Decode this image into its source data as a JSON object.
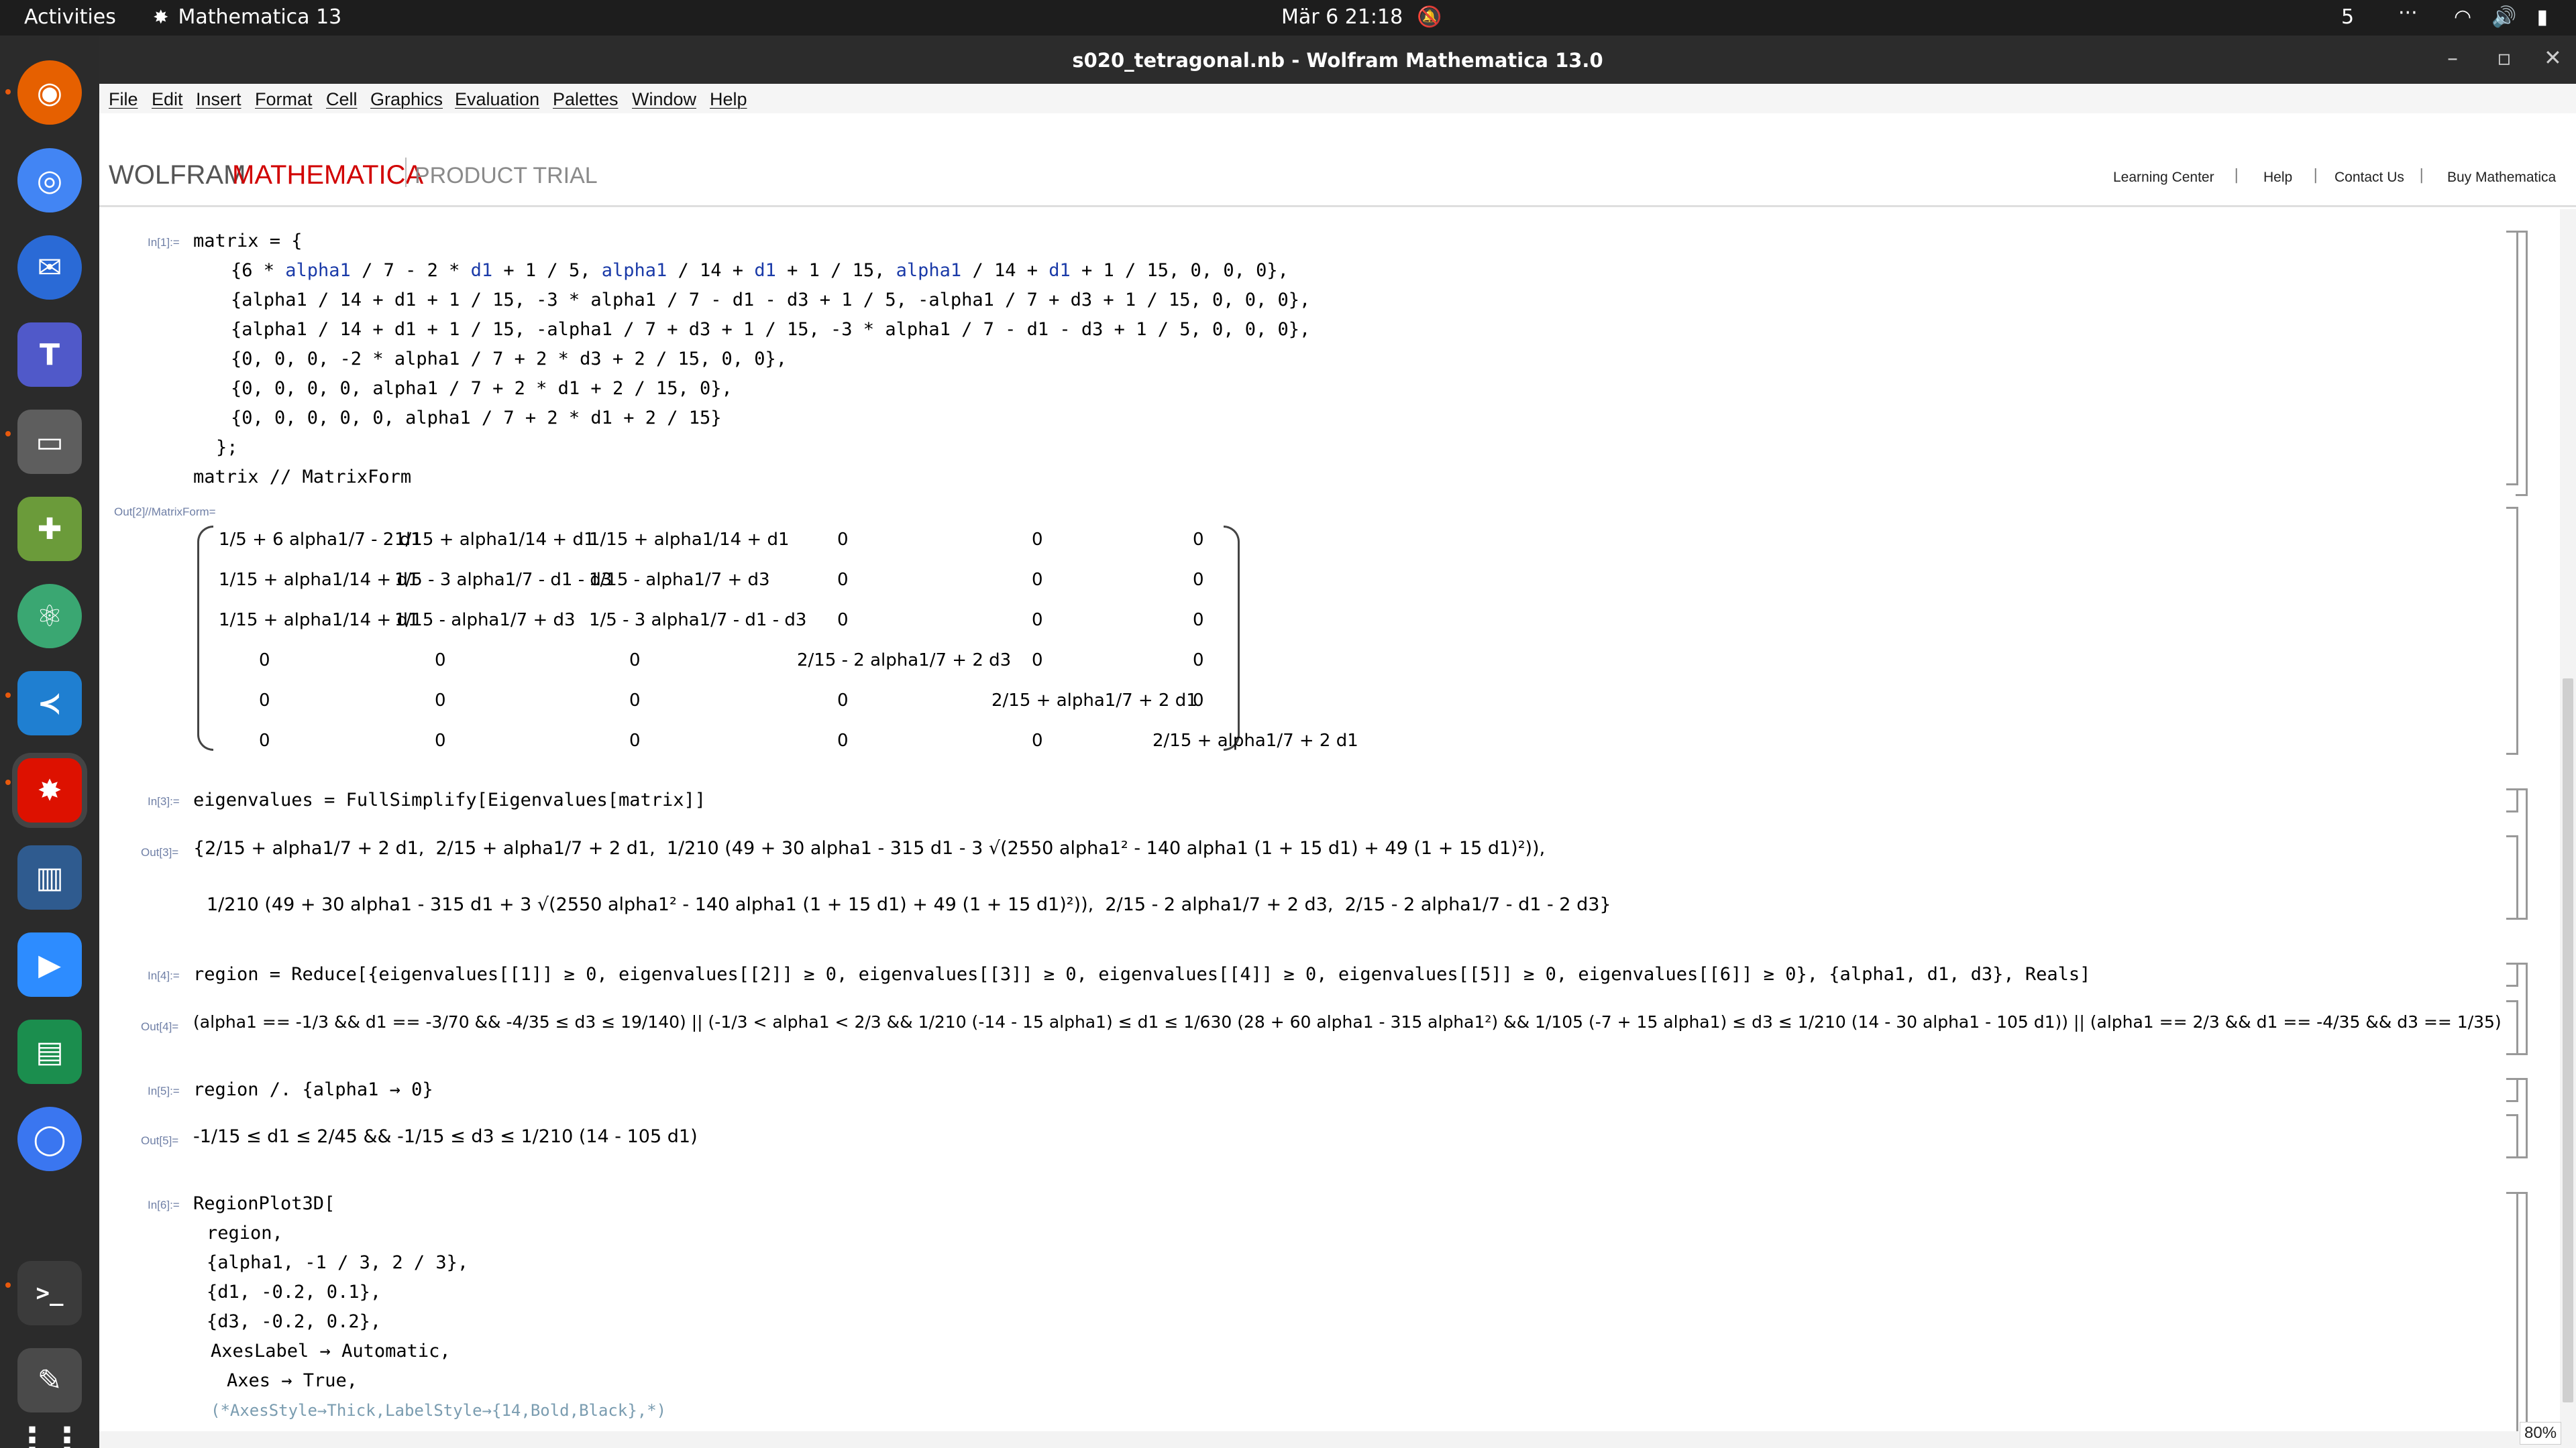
{
  "topbar": {
    "activities": "Activities",
    "app_name": "Mathematica 13",
    "clock": "Mär 6  21:18",
    "workspace": "5",
    "overflow": "···"
  },
  "window": {
    "title": "s020_tetragonal.nb - Wolfram Mathematica 13.0",
    "minimize": "–",
    "maximize": "▫",
    "close": "✕"
  },
  "menu": [
    "File",
    "Edit",
    "Insert",
    "Format",
    "Cell",
    "Graphics",
    "Evaluation",
    "Palettes",
    "Window",
    "Help"
  ],
  "brand": {
    "wolfram": "WOLFRAM",
    "mathematica": "MATHEMATICA",
    "trial": "PRODUCT TRIAL",
    "links": [
      "Learning Center",
      "Help",
      "Contact Us",
      "Buy Mathematica"
    ]
  },
  "cells": {
    "in1_label": "In[1]:=",
    "in1_line1": "matrix = {",
    "in1_line2a": "{6 * ",
    "in1_line2b": "alpha1",
    "in1_line2c": " / 7 - 2 * ",
    "in1_line2d": "d1",
    "in1_line2e": " + 1 / 5, ",
    "in1_line2f": "alpha1",
    "in1_line2g": " / 14 + ",
    "in1_line2h": "d1",
    "in1_line2i": " + 1 / 15, ",
    "in1_line2j": "alpha1",
    "in1_line2k": " / 14 + ",
    "in1_line2l": "d1",
    "in1_line2m": " + 1 / 15, 0, 0, 0},",
    "in1_line3": "{alpha1 / 14 + d1 + 1 / 15, -3 * alpha1 / 7 - d1 - d3 + 1 / 5, -alpha1 / 7 + d3 + 1 / 15, 0, 0, 0},",
    "in1_line4": "{alpha1 / 14 + d1 + 1 / 15, -alpha1 / 7 + d3 + 1 / 15, -3 * alpha1 / 7 - d1 - d3 + 1 / 5, 0, 0, 0},",
    "in1_line5": "{0, 0, 0, -2 * alpha1 / 7 + 2 * d3 + 2 / 15, 0, 0},",
    "in1_line6": "{0, 0, 0, 0, alpha1 / 7 + 2 * d1 + 2 / 15, 0},",
    "in1_line7": "{0, 0, 0, 0, 0, alpha1 / 7 + 2 * d1 + 2 / 15}",
    "in1_line8": "};",
    "in1_line9": "matrix // MatrixForm",
    "out2_label": "Out[2]//MatrixForm=",
    "in3_label": "In[3]:=",
    "in3_code": "eigenvalues = FullSimplify[Eigenvalues[matrix]]",
    "out3_label": "Out[3]=",
    "out3_line1": "{2/15 + alpha1/7 + 2 d1,  2/15 + alpha1/7 + 2 d1,  1/210 (49 + 30 alpha1 - 315 d1 - 3 √(2550 alpha1² - 140 alpha1 (1 + 15 d1) + 49 (1 + 15 d1)²)),",
    "out3_line2": "1/210 (49 + 30 alpha1 - 315 d1 + 3 √(2550 alpha1² - 140 alpha1 (1 + 15 d1) + 49 (1 + 15 d1)²)),  2/15 - 2 alpha1/7 + 2 d3,  2/15 - 2 alpha1/7 - d1 - 2 d3}",
    "in4_label": "In[4]:=",
    "in4_code": "region = Reduce[{eigenvalues[[1]] ≥ 0, eigenvalues[[2]] ≥ 0, eigenvalues[[3]] ≥ 0, eigenvalues[[4]] ≥ 0, eigenvalues[[5]] ≥ 0, eigenvalues[[6]] ≥ 0}, {alpha1, d1, d3}, Reals]",
    "out4_label": "Out[4]=",
    "out4_text": "(alpha1 == -1/3 && d1 == -3/70 && -4/35 ≤ d3 ≤ 19/140) || (-1/3 < alpha1 < 2/3 && 1/210 (-14 - 15 alpha1) ≤ d1 ≤ 1/630 (28 + 60 alpha1 - 315 alpha1²) && 1/105 (-7 + 15 alpha1) ≤ d3 ≤ 1/210 (14 - 30 alpha1 - 105 d1)) || (alpha1 == 2/3 && d1 == -4/35 && d3 == 1/35)",
    "in5_label": "In[5]:=",
    "in5_code": "region /. {alpha1 → 0}",
    "out5_label": "Out[5]=",
    "out5_text": "-1/15 ≤ d1 ≤ 2/45 && -1/15 ≤ d3 ≤ 1/210 (14 - 105 d1)",
    "in6_label": "In[6]:=",
    "in6_line1": "RegionPlot3D[",
    "in6_line2": "region,",
    "in6_line3": "{alpha1, -1 / 3, 2 / 3},",
    "in6_line4": "{d1, -0.2, 0.1},",
    "in6_line5": "{d3, -0.2, 0.2},",
    "in6_line6": "AxesLabel → Automatic,",
    "in6_line7": "Axes → True,",
    "in6_line8": "(*AxesStyle→Thick,LabelStyle→{14,Bold,Black},*)"
  },
  "matrix": [
    [
      "1/5 + 6 alpha1/7 - 2 d1",
      "1/15 + alpha1/14 + d1",
      "1/15 + alpha1/14 + d1",
      "0",
      "0",
      "0"
    ],
    [
      "1/15 + alpha1/14 + d1",
      "1/5 - 3 alpha1/7 - d1 - d3",
      "1/15 - alpha1/7 + d3",
      "0",
      "0",
      "0"
    ],
    [
      "1/15 + alpha1/14 + d1",
      "1/15 - alpha1/7 + d3",
      "1/5 - 3 alpha1/7 - d1 - d3",
      "0",
      "0",
      "0"
    ],
    [
      "0",
      "0",
      "0",
      "2/15 - 2 alpha1/7 + 2 d3",
      "0",
      "0"
    ],
    [
      "0",
      "0",
      "0",
      "0",
      "2/15 + alpha1/7 + 2 d1",
      "0"
    ],
    [
      "0",
      "0",
      "0",
      "0",
      "0",
      "2/15 + alpha1/7 + 2 d1"
    ]
  ],
  "zoom": "80%",
  "dock_apps": [
    "Firefox",
    "Chrome",
    "Thunderbird",
    "Teams",
    "Files",
    "Extensions",
    "Atom",
    "VS Code",
    "Mathematica",
    "Calibre",
    "Zoom",
    "Notes",
    "Signal",
    "Terminal",
    "Editor",
    "Show Apps"
  ]
}
